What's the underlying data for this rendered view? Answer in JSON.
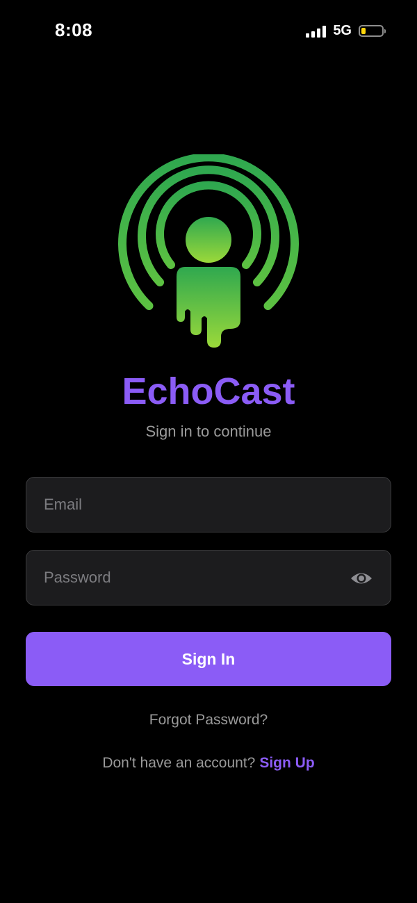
{
  "status_bar": {
    "time": "8:08",
    "network": "5G",
    "signal_icon": "cellular-signal-icon",
    "battery_icon": "battery-low-icon",
    "battery_level": 0.2,
    "battery_color": "#ffd60a"
  },
  "logo": {
    "icon": "podcast-broadcast-person-icon",
    "gradient_top": "#2fa84f",
    "gradient_bottom": "#9bd93a"
  },
  "header": {
    "app_name": "EchoCast",
    "subtitle": "Sign in to continue"
  },
  "form": {
    "email_placeholder": "Email",
    "email_value": "",
    "password_placeholder": "Password",
    "password_value": "",
    "password_toggle_icon": "eye-icon",
    "sign_in_label": "Sign In"
  },
  "links": {
    "forgot_password": "Forgot Password?",
    "no_account_prompt": "Don't have an account?",
    "sign_up": "Sign Up"
  },
  "colors": {
    "accent": "#8b5cf6",
    "background": "#000000",
    "field_background": "#1c1c1e"
  }
}
